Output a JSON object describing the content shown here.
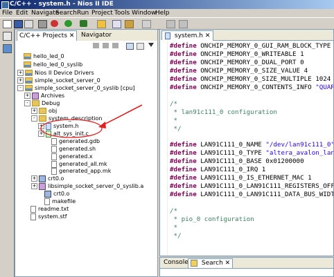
{
  "window": {
    "title": "C/C++ - system.h - Nios II IDE"
  },
  "menu": [
    "File",
    "Edit",
    "Navigate",
    "Search",
    "Run",
    "Project",
    "Tools",
    "Window",
    "Help"
  ],
  "left_panel": {
    "tabs": [
      {
        "label": "C/C++ Projects",
        "close": "✕"
      },
      {
        "label": "Navigator"
      }
    ]
  },
  "tree": [
    {
      "label": "hello_led_0",
      "icon": "project-icon",
      "expander": ""
    },
    {
      "label": "hello_led_0_syslib",
      "icon": "project-icon",
      "expander": ""
    },
    {
      "label": "Nios II Device Drivers",
      "icon": "project-icon",
      "expander": "+"
    },
    {
      "label": "simple_socket_server_0",
      "icon": "project-icon",
      "expander": "+"
    },
    {
      "label": "simple_socket_server_0_syslib [cpu]",
      "icon": "project-icon",
      "expander": "-"
    },
    {
      "label": "Archives",
      "icon": "archive-icon",
      "expander": "+"
    },
    {
      "label": "Debug",
      "icon": "folder-icon",
      "expander": "-"
    },
    {
      "label": "obj",
      "icon": "folder-icon",
      "expander": "+"
    },
    {
      "label": "system_description",
      "icon": "folder-icon",
      "expander": "-"
    },
    {
      "label": "system.h",
      "icon": "header-file-icon",
      "expander": "+"
    },
    {
      "label": "alt_sys_init.c",
      "icon": "c-file-icon",
      "expander": "+"
    },
    {
      "label": "generated.gdb",
      "icon": "file-icon",
      "expander": ""
    },
    {
      "label": "generated.sh",
      "icon": "file-icon",
      "expander": ""
    },
    {
      "label": "generated.x",
      "icon": "file-icon",
      "expander": ""
    },
    {
      "label": "generated_all.mk",
      "icon": "file-icon",
      "expander": ""
    },
    {
      "label": "generated_app.mk",
      "icon": "file-icon",
      "expander": ""
    },
    {
      "label": "crt0.o",
      "icon": "binary-icon",
      "expander": "+"
    },
    {
      "label": "libsimple_socket_server_0_syslib.a",
      "icon": "archive-icon",
      "expander": "+"
    },
    {
      "label": "crt0.o",
      "icon": "binary-icon",
      "expander": ""
    },
    {
      "label": "makefile",
      "icon": "file-icon",
      "expander": ""
    },
    {
      "label": "readme.txt",
      "icon": "file-icon",
      "expander": ""
    },
    {
      "label": "system.stf",
      "icon": "file-icon",
      "expander": ""
    }
  ],
  "editor": {
    "tab_label": "system.h",
    "tab_close": "✕",
    "lines": [
      {
        "kind": "define",
        "kw": "#define",
        "text": " ONCHIP_MEMORY_0_GUI_RAM_BLOCK_TYPE",
        "str": ""
      },
      {
        "kind": "define",
        "kw": "#define",
        "text": " ONCHIP_MEMORY_0_WRITEABLE 1",
        "str": ""
      },
      {
        "kind": "define",
        "kw": "#define",
        "text": " ONCHIP_MEMORY_0_DUAL_PORT 0",
        "str": ""
      },
      {
        "kind": "define",
        "kw": "#define",
        "text": " ONCHIP_MEMORY_0_SIZE_VALUE 4",
        "str": ""
      },
      {
        "kind": "define",
        "kw": "#define",
        "text": " ONCHIP_MEMORY_0_SIZE_MULTIPLE 1024",
        "str": ""
      },
      {
        "kind": "define",
        "kw": "#define",
        "text": " ONCHIP_MEMORY_0_CONTENTS_INFO ",
        "str": "\"QUAR"
      },
      {
        "kind": "blank"
      },
      {
        "kind": "comment",
        "text": "/*"
      },
      {
        "kind": "comment",
        "text": " * lan91c111_0 configuration"
      },
      {
        "kind": "comment",
        "text": " *"
      },
      {
        "kind": "comment",
        "text": " */"
      },
      {
        "kind": "blank"
      },
      {
        "kind": "define",
        "kw": "#define",
        "text": " LAN91C111_0_NAME ",
        "str": "\"/dev/lan91c111_0\""
      },
      {
        "kind": "define",
        "kw": "#define",
        "text": " LAN91C111_0_TYPE ",
        "str": "\"altera_avalon_lan"
      },
      {
        "kind": "define",
        "kw": "#define",
        "text": " LAN91C111_0_BASE 0x01200000",
        "str": ""
      },
      {
        "kind": "define",
        "kw": "#define",
        "text": " LAN91C111_0_IRQ 1",
        "str": ""
      },
      {
        "kind": "define",
        "kw": "#define",
        "text": " LAN91C111_0_IS_ETHERNET_MAC 1",
        "str": ""
      },
      {
        "kind": "define",
        "kw": "#define",
        "text": " LAN91C111_0_LAN91C111_REGISTERS_OFF",
        "str": ""
      },
      {
        "kind": "define",
        "kw": "#define",
        "text": " LAN91C111_0_LAN91C111_DATA_BUS_WIDT",
        "str": ""
      },
      {
        "kind": "blank"
      },
      {
        "kind": "comment",
        "text": "/*"
      },
      {
        "kind": "comment",
        "text": " * pio_0 configuration"
      },
      {
        "kind": "comment",
        "text": " *"
      },
      {
        "kind": "comment",
        "text": " */"
      }
    ]
  },
  "bottom_panel": {
    "tabs": [
      {
        "label": "Console"
      },
      {
        "label": "Search",
        "close": "✕"
      }
    ]
  },
  "colors": {
    "keyword": "#7f0055",
    "string": "#2a00ff",
    "comment": "#3f7f5f",
    "annotation": "#e02020"
  }
}
